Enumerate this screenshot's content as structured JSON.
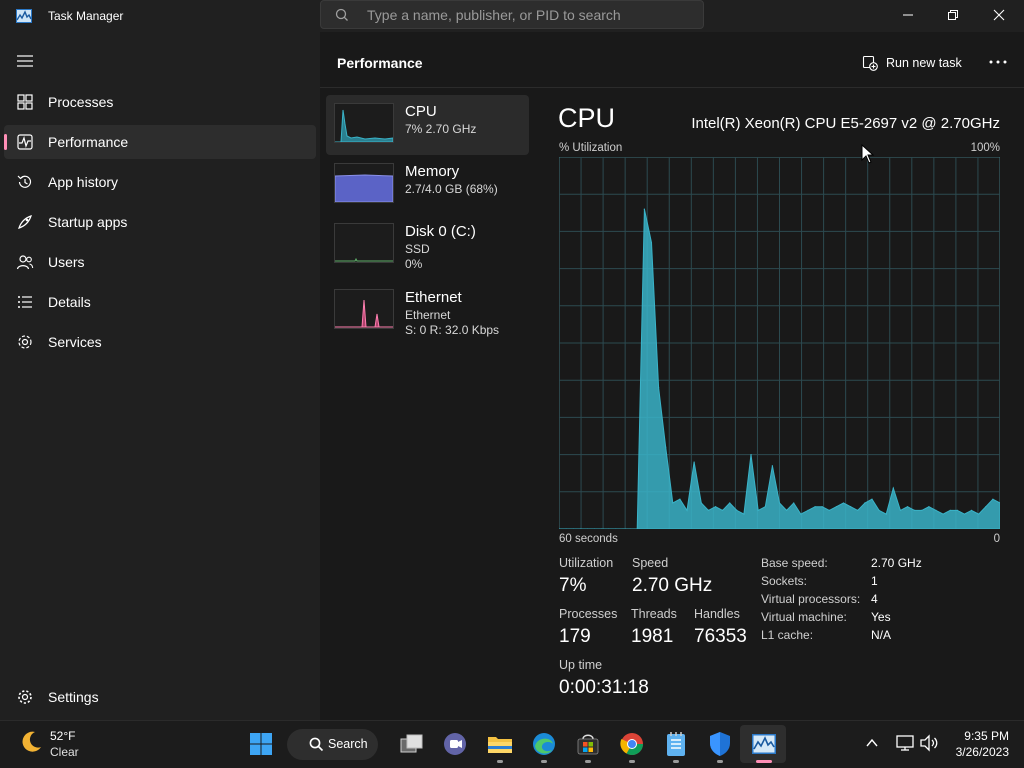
{
  "window": {
    "title": "Task Manager"
  },
  "search": {
    "placeholder": "Type a name, publisher, or PID to search"
  },
  "nav": {
    "items": [
      {
        "label": "Processes",
        "icon": "processes-icon"
      },
      {
        "label": "Performance",
        "icon": "performance-icon"
      },
      {
        "label": "App history",
        "icon": "history-icon"
      },
      {
        "label": "Startup apps",
        "icon": "startup-icon"
      },
      {
        "label": "Users",
        "icon": "users-icon"
      },
      {
        "label": "Details",
        "icon": "details-icon"
      },
      {
        "label": "Services",
        "icon": "services-icon"
      }
    ],
    "settings_label": "Settings",
    "active": "Performance"
  },
  "header": {
    "title": "Performance",
    "run_task_label": "Run new task"
  },
  "tiles": [
    {
      "name": "CPU",
      "line1": "7%  2.70 GHz",
      "line2": ""
    },
    {
      "name": "Memory",
      "line1": "2.7/4.0 GB (68%)",
      "line2": ""
    },
    {
      "name": "Disk 0 (C:)",
      "line1": "SSD",
      "line2": "0%"
    },
    {
      "name": "Ethernet",
      "line1": "Ethernet",
      "line2": "S: 0 R: 32.0 Kbps"
    }
  ],
  "cpu": {
    "title": "CPU",
    "model": "Intel(R) Xeon(R) CPU E5-2697 v2 @ 2.70GHz",
    "util_label": "% Utilization",
    "max_label": "100%",
    "time_label": "60 seconds",
    "min_label": "0"
  },
  "stats": {
    "utilization_label": "Utilization",
    "utilization": "7%",
    "speed_label": "Speed",
    "speed": "2.70 GHz",
    "processes_label": "Processes",
    "processes": "179",
    "threads_label": "Threads",
    "threads": "1981",
    "handles_label": "Handles",
    "handles": "76353",
    "uptime_label": "Up time",
    "uptime": "0:00:31:18"
  },
  "specs": [
    {
      "key": "Base speed:",
      "value": "2.70 GHz"
    },
    {
      "key": "Sockets:",
      "value": "1"
    },
    {
      "key": "Virtual processors:",
      "value": "4"
    },
    {
      "key": "Virtual machine:",
      "value": "Yes"
    },
    {
      "key": "L1 cache:",
      "value": "N/A"
    }
  ],
  "chart_data": {
    "type": "area",
    "title": "",
    "xlabel": "60 seconds",
    "ylabel": "% Utilization",
    "xlim": [
      60,
      0
    ],
    "ylim": [
      0,
      100
    ],
    "grid": true,
    "values": [
      0,
      0,
      0,
      0,
      0,
      0,
      0,
      0,
      0,
      0,
      0,
      0,
      86,
      77,
      38,
      22,
      7,
      8,
      5,
      18,
      7,
      5,
      6,
      5,
      7,
      5,
      4,
      20,
      5,
      6,
      17,
      7,
      5,
      7,
      4,
      5,
      6,
      6,
      5,
      6,
      7,
      6,
      5,
      7,
      8,
      5,
      4,
      11,
      5,
      6,
      5,
      5,
      6,
      5,
      4,
      5,
      5,
      4,
      5,
      4,
      6,
      8,
      7
    ],
    "color": "#3ab3c8"
  },
  "taskbar": {
    "weather_temp": "52°F",
    "weather_desc": "Clear",
    "search_label": "Search",
    "time": "9:35 PM",
    "date": "3/26/2023"
  }
}
